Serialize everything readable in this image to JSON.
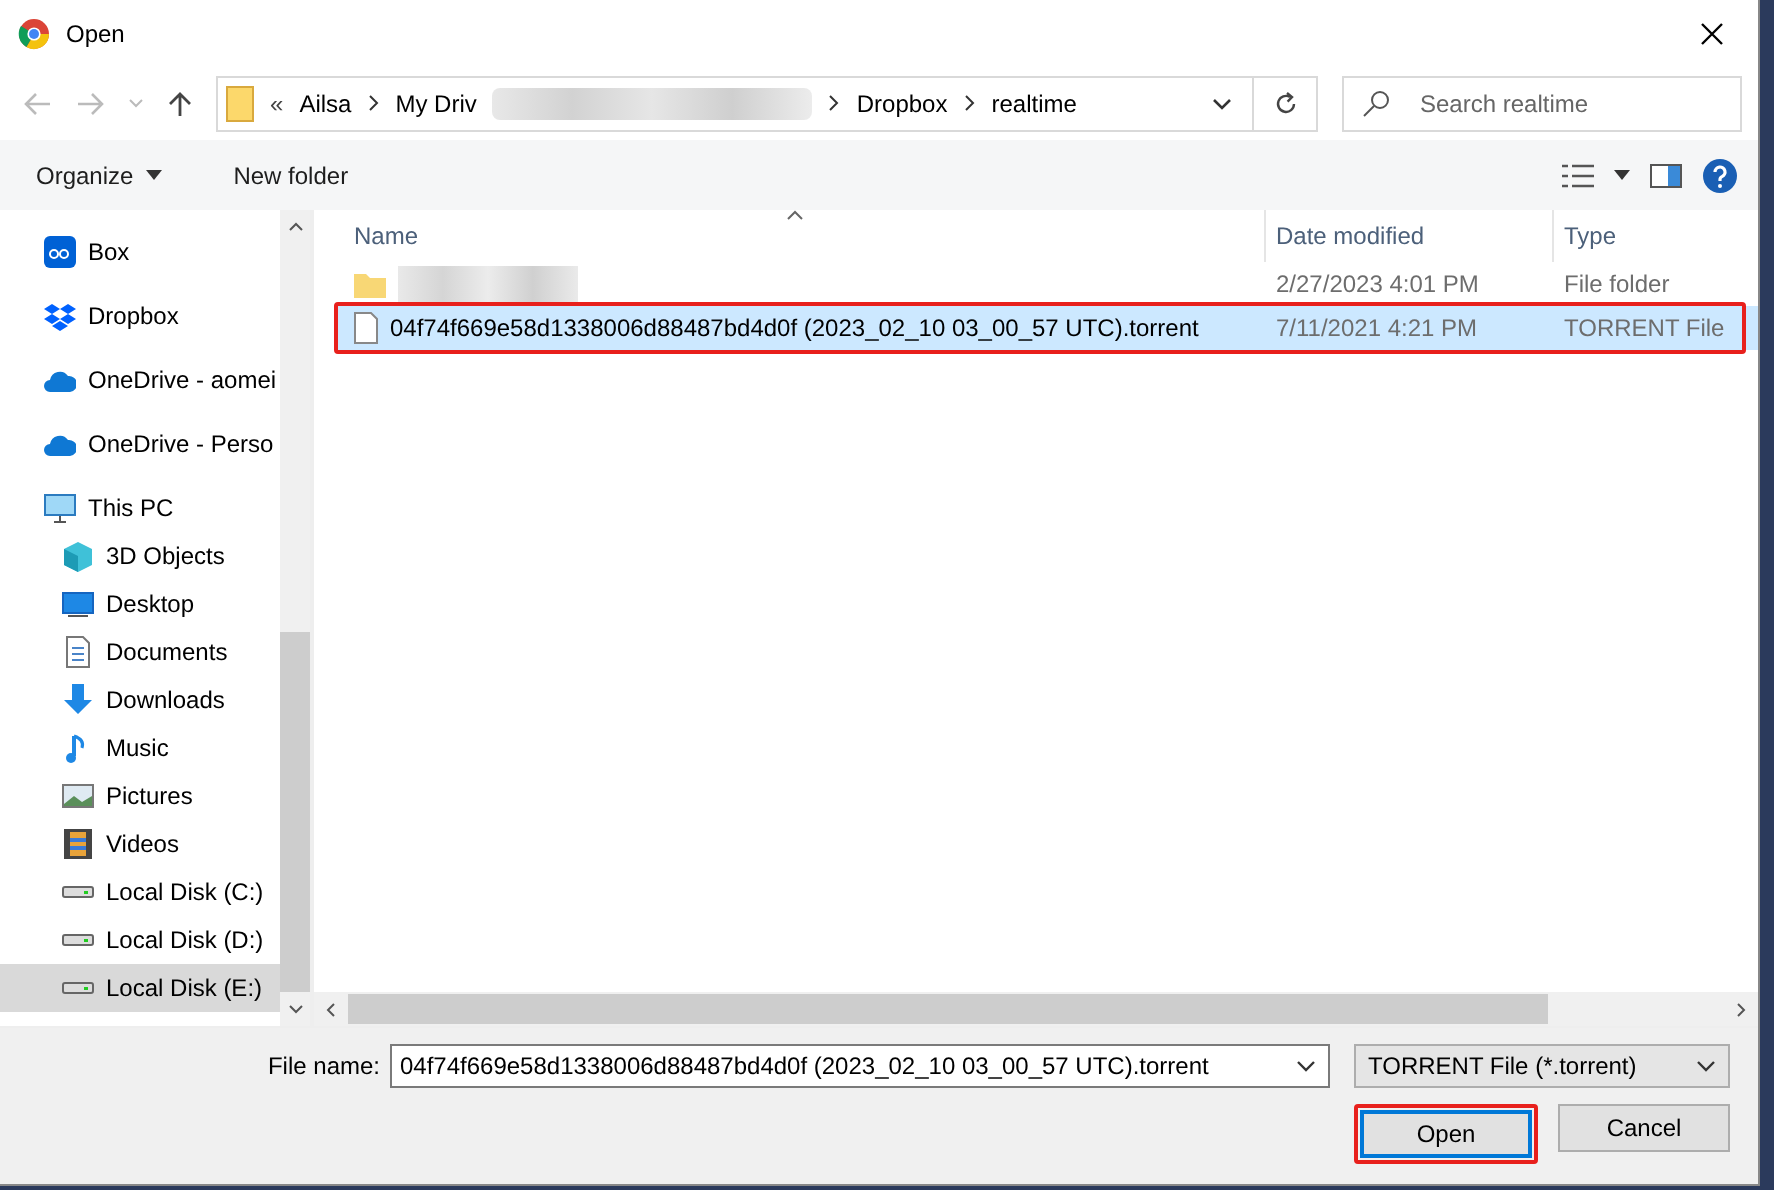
{
  "window": {
    "title": "Open"
  },
  "address": {
    "overflow": "«",
    "crumbs": [
      "Ailsa",
      "My Driv",
      "Dropbox",
      "realtime"
    ]
  },
  "search": {
    "placeholder": "Search realtime"
  },
  "toolbar": {
    "organize": "Organize",
    "new_folder": "New folder"
  },
  "sidebar": {
    "items": [
      {
        "label": "Box",
        "selected": false
      },
      {
        "label": "Dropbox",
        "selected": false
      },
      {
        "label": "OneDrive - aomei",
        "selected": false
      },
      {
        "label": "OneDrive - Perso",
        "selected": false
      },
      {
        "label": "This PC",
        "selected": false
      },
      {
        "label": "3D Objects",
        "selected": false
      },
      {
        "label": "Desktop",
        "selected": false
      },
      {
        "label": "Documents",
        "selected": false
      },
      {
        "label": "Downloads",
        "selected": false
      },
      {
        "label": "Music",
        "selected": false
      },
      {
        "label": "Pictures",
        "selected": false
      },
      {
        "label": "Videos",
        "selected": false
      },
      {
        "label": "Local Disk (C:)",
        "selected": false
      },
      {
        "label": "Local Disk (D:)",
        "selected": false
      },
      {
        "label": "Local Disk (E:)",
        "selected": true
      }
    ]
  },
  "table": {
    "columns": [
      "Name",
      "Date modified",
      "Type"
    ],
    "rows": [
      {
        "kind": "folder",
        "date": "2/27/2023 4:01 PM",
        "type": "File folder",
        "selected": false
      },
      {
        "kind": "file",
        "name": "04f74f669e58d1338006d88487bd4d0f (2023_02_10 03_00_57 UTC).torrent",
        "date": "7/11/2021 4:21 PM",
        "type": "TORRENT File",
        "selected": true
      }
    ]
  },
  "footer": {
    "file_name_label": "File name:",
    "file_name": "04f74f669e58d1338006d88487bd4d0f (2023_02_10 03_00_57 UTC).torrent",
    "filter": "TORRENT File (*.torrent)",
    "open": "Open",
    "cancel": "Cancel"
  }
}
